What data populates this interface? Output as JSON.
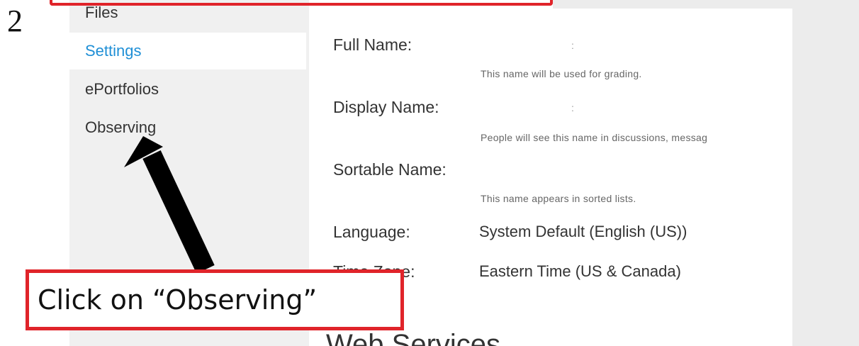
{
  "step_number": "2",
  "sidebar": {
    "items": [
      {
        "label": "Files"
      },
      {
        "label": "Settings"
      },
      {
        "label": "ePortfolios"
      },
      {
        "label": "Observing"
      }
    ],
    "active": "Settings"
  },
  "settings": {
    "full_name": {
      "label": "Full Name:",
      "value": ":",
      "hint": "This name will be used for grading."
    },
    "display_name": {
      "label": "Display Name:",
      "value": ":",
      "hint": "People will see this name in discussions, messag"
    },
    "sortable_name": {
      "label": "Sortable Name:",
      "hint": "This name appears in sorted lists."
    },
    "language": {
      "label": "Language:",
      "value": "System Default (English (US))"
    },
    "time_zone": {
      "label": "Time Zone:",
      "value": "Eastern Time (US & Canada)"
    },
    "web_services_heading": "Web Services"
  },
  "annotation": {
    "callout_text": "Click on “Observing”",
    "arrow_color": "#000000",
    "highlight_color": "#e0242a"
  },
  "colors": {
    "accent": "#1f8fd6",
    "sidebar_bg": "#f0f0f0"
  }
}
